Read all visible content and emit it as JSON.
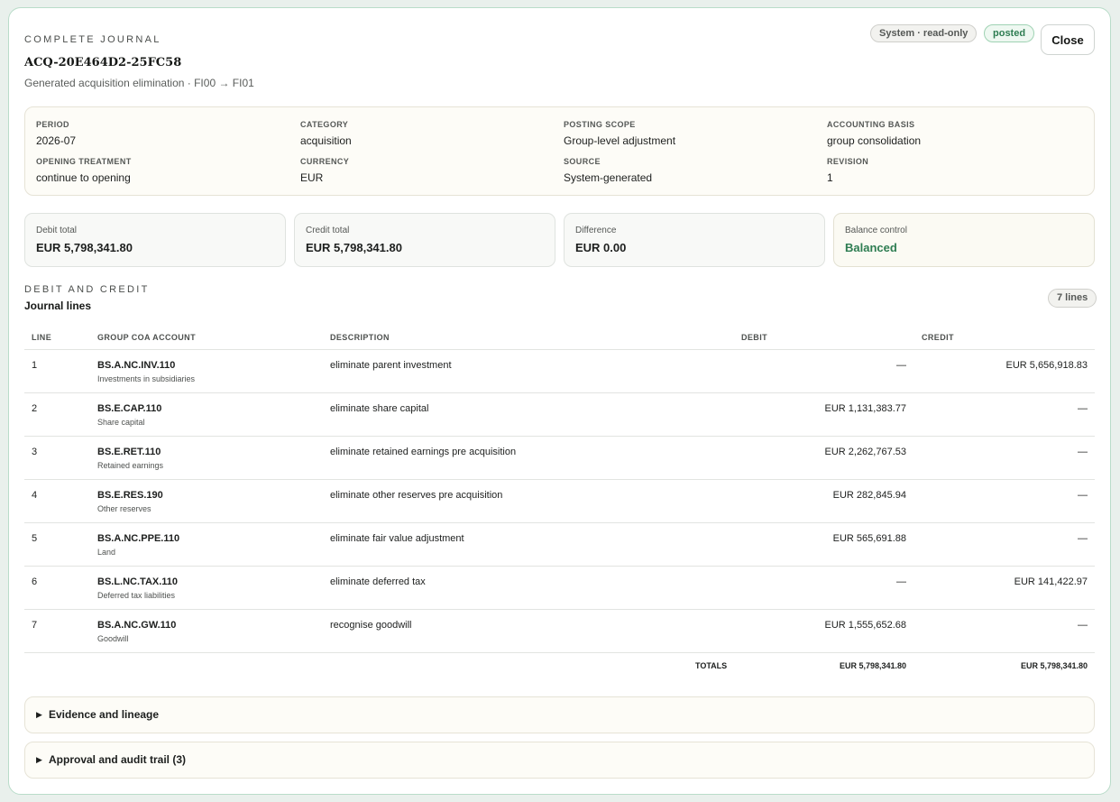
{
  "header": {
    "eyebrow": "COMPLETE JOURNAL",
    "journal_id": "ACQ-20E464D2-25FC58",
    "subtitle": "Generated acquisition elimination · FI00 → FI01",
    "readonly_chip": "System · read-only",
    "status_chip": "posted",
    "close_label": "Close"
  },
  "meta": {
    "period_label": "PERIOD",
    "period_value": "2026-07",
    "category_label": "CATEGORY",
    "category_value": "acquisition",
    "scope_label": "POSTING SCOPE",
    "scope_value": "Group-level adjustment",
    "basis_label": "ACCOUNTING BASIS",
    "basis_value": "group consolidation",
    "opening_label": "OPENING TREATMENT",
    "opening_value": "continue to opening",
    "currency_label": "CURRENCY",
    "currency_value": "EUR",
    "source_label": "SOURCE",
    "source_value": "System-generated",
    "revision_label": "REVISION",
    "revision_value": "1"
  },
  "stats": {
    "debit_label": "Debit total",
    "debit_value": "EUR 5,798,341.80",
    "credit_label": "Credit total",
    "credit_value": "EUR 5,798,341.80",
    "diff_label": "Difference",
    "diff_value": "EUR 0.00",
    "balance_label": "Balance control",
    "balance_value": "Balanced",
    "balance_color": "#2e7d52"
  },
  "lines_section": {
    "eyebrow": "DEBIT AND CREDIT",
    "title": "Journal lines",
    "count_chip": "7 lines",
    "columns": [
      "LINE",
      "GROUP COA ACCOUNT",
      "DESCRIPTION",
      "DEBIT",
      "CREDIT"
    ],
    "rows": [
      {
        "line": "1",
        "account": "BS.A.NC.INV.110",
        "account_name": "Investments in subsidiaries",
        "description": "eliminate parent investment",
        "debit": "—",
        "credit": "EUR 5,656,918.83"
      },
      {
        "line": "2",
        "account": "BS.E.CAP.110",
        "account_name": "Share capital",
        "description": "eliminate share capital",
        "debit": "EUR 1,131,383.77",
        "credit": "—"
      },
      {
        "line": "3",
        "account": "BS.E.RET.110",
        "account_name": "Retained earnings",
        "description": "eliminate retained earnings pre acquisition",
        "debit": "EUR 2,262,767.53",
        "credit": "—"
      },
      {
        "line": "4",
        "account": "BS.E.RES.190",
        "account_name": "Other reserves",
        "description": "eliminate other reserves pre acquisition",
        "debit": "EUR 282,845.94",
        "credit": "—"
      },
      {
        "line": "5",
        "account": "BS.A.NC.PPE.110",
        "account_name": "Land",
        "description": "eliminate fair value adjustment",
        "debit": "EUR 565,691.88",
        "credit": "—"
      },
      {
        "line": "6",
        "account": "BS.L.NC.TAX.110",
        "account_name": "Deferred tax liabilities",
        "description": "eliminate deferred tax",
        "debit": "—",
        "credit": "EUR 141,422.97"
      },
      {
        "line": "7",
        "account": "BS.A.NC.GW.110",
        "account_name": "Goodwill",
        "description": "recognise goodwill",
        "debit": "EUR 1,555,652.68",
        "credit": "—"
      }
    ],
    "totals_label": "TOTALS",
    "totals_debit": "EUR 5,798,341.80",
    "totals_credit": "EUR 5,798,341.80"
  },
  "expanders": {
    "evidence_label": "Evidence and lineage",
    "audit_label": "Approval and audit trail (3)",
    "arrow_icon": "triangle-right-icon"
  }
}
